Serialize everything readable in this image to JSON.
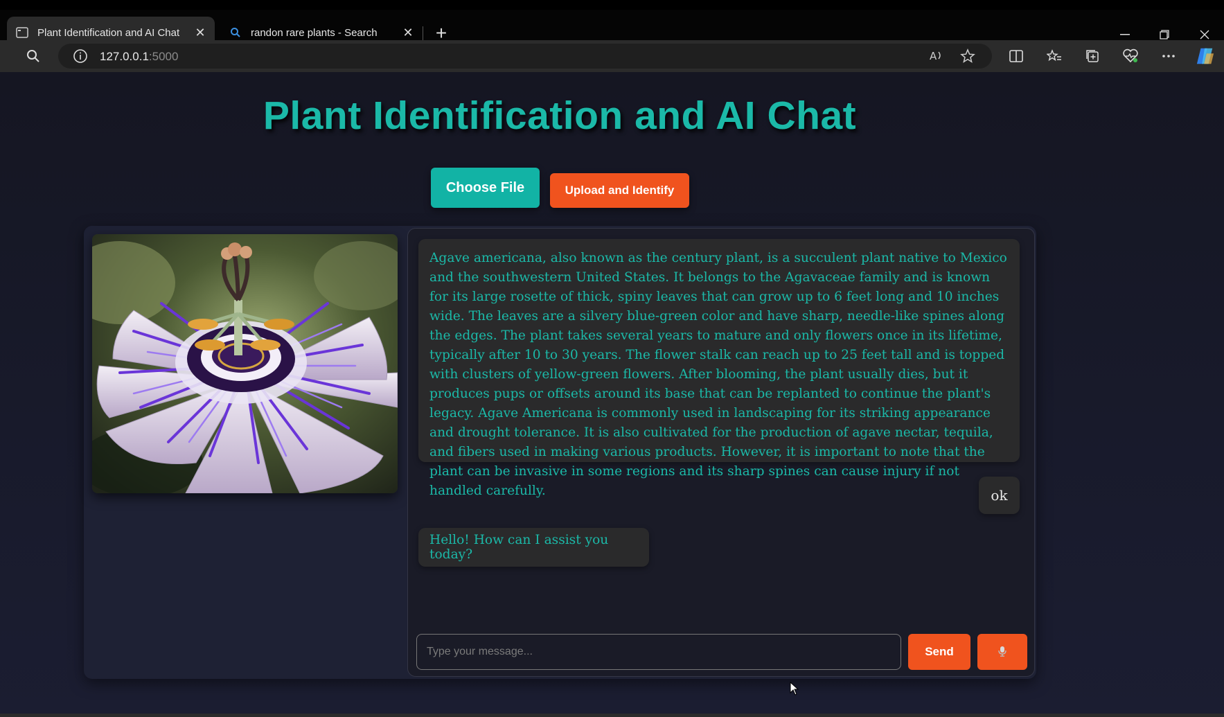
{
  "browser": {
    "tabs": [
      {
        "title": "Plant Identification and AI Chat",
        "active": true,
        "icon": "page-icon"
      },
      {
        "title": "randon rare plants - Search",
        "active": false,
        "icon": "search-icon"
      }
    ],
    "address": {
      "host": "127.0.0.1",
      "port": ":5000"
    }
  },
  "page": {
    "title": "Plant Identification and AI Chat",
    "choose_file_label": "Choose File",
    "upload_label": "Upload and Identify"
  },
  "chat": {
    "messages": [
      {
        "role": "bot",
        "text": "Agave americana, also known as the century plant, is a succulent plant native to Mexico and the southwestern United States. It belongs to the Agavaceae family and is known for its large rosette of thick, spiny leaves that can grow up to 6 feet long and 10 inches wide. The leaves are a silvery blue-green color and have sharp, needle-like spines along the edges. The plant takes several years to mature and only flowers once in its lifetime, typically after 10 to 30 years. The flower stalk can reach up to 25 feet tall and is topped with clusters of yellow-green flowers. After blooming, the plant usually dies, but it produces pups or offsets around its base that can be replanted to continue the plant's legacy. Agave Americana is commonly used in landscaping for its striking appearance and drought tolerance. It is also cultivated for the production of agave nectar, tequila, and fibers used in making various products. However, it is important to note that the plant can be invasive in some regions and its sharp spines can cause injury if not handled carefully."
      },
      {
        "role": "user",
        "text": "ok"
      },
      {
        "role": "bot",
        "text": "Hello! How can I assist you today?"
      }
    ],
    "input_placeholder": "Type your message...",
    "send_label": "Send"
  },
  "colors": {
    "accent_teal": "#1bb9a8",
    "accent_orange": "#f0531e",
    "panel": "#1e2134"
  }
}
